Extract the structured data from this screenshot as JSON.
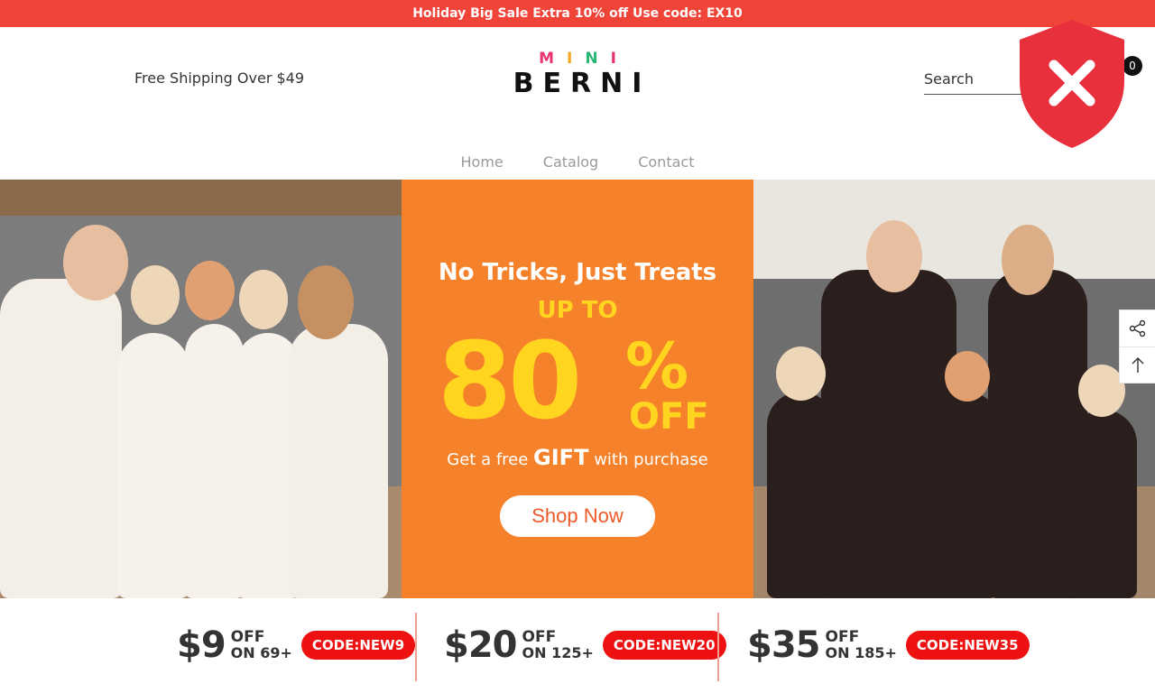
{
  "announcement": "Holiday Big Sale Extra 10% off Use code: EX10",
  "header": {
    "free_shipping": "Free Shipping Over $49",
    "logo_top": "MINI",
    "logo_main": "BERNI",
    "search_placeholder": "Search",
    "cart_count": "0"
  },
  "nav": [
    "Home",
    "Catalog",
    "Contact"
  ],
  "hero": {
    "line1": "No Tricks, Just Treats",
    "up_to": "UP TO",
    "big_number": "80",
    "percent": "%",
    "off": "OFF",
    "gift_pre": "Get a free",
    "gift_word": "GIFT",
    "gift_post": "with purchase",
    "button": "Shop Now"
  },
  "coupons": [
    {
      "amount": "$9",
      "off": "OFF",
      "on": "ON 69+",
      "code": "CODE:NEW9"
    },
    {
      "amount": "$20",
      "off": "OFF",
      "on": "ON 125+",
      "code": "CODE:NEW20"
    },
    {
      "amount": "$35",
      "off": "OFF",
      "on": "ON 185+",
      "code": "CODE:NEW35"
    }
  ],
  "colors": {
    "announce_bg": "#f04438",
    "promo_bg": "#f5822a",
    "promo_yellow": "#ffd51f",
    "coupon_red": "#ee1111",
    "shield_red": "#e8303d"
  },
  "icons": [
    "shield-x-icon",
    "share-icon",
    "arrow-up-icon"
  ]
}
